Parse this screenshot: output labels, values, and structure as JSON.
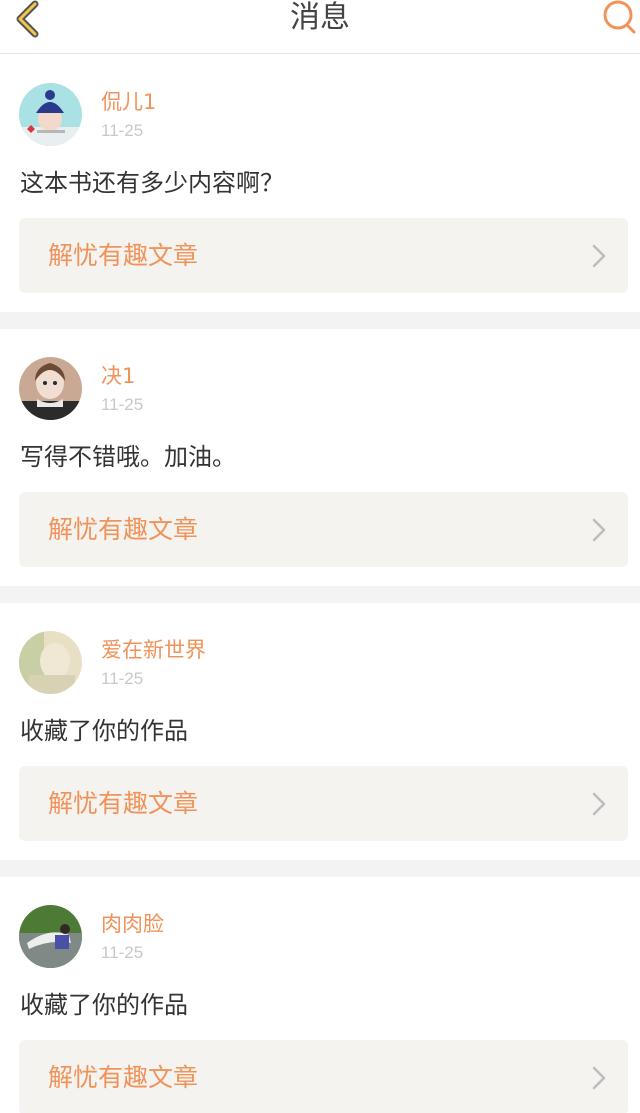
{
  "header": {
    "title": "消息",
    "back_icon": "chevron-left-icon",
    "search_icon": "search-icon",
    "accent_color": "#f0935a"
  },
  "messages": [
    {
      "username": "侃儿1",
      "time": "11-25",
      "content": "这本书还有多少内容啊？",
      "article_title": "解忧有趣文章",
      "avatar": "avatar-girl-hat"
    },
    {
      "username": "决1",
      "time": "11-25",
      "content": "写得不错哦。加油。",
      "article_title": "解忧有趣文章",
      "avatar": "avatar-child-scarf"
    },
    {
      "username": "爱在新世界",
      "time": "11-25",
      "content": "收藏了你的作品",
      "article_title": "解忧有趣文章",
      "avatar": "avatar-faded-photo"
    },
    {
      "username": "肉肉脸",
      "time": "11-25",
      "content": "收藏了你的作品",
      "article_title": "解忧有趣文章",
      "avatar": "avatar-outdoor-figure"
    }
  ]
}
